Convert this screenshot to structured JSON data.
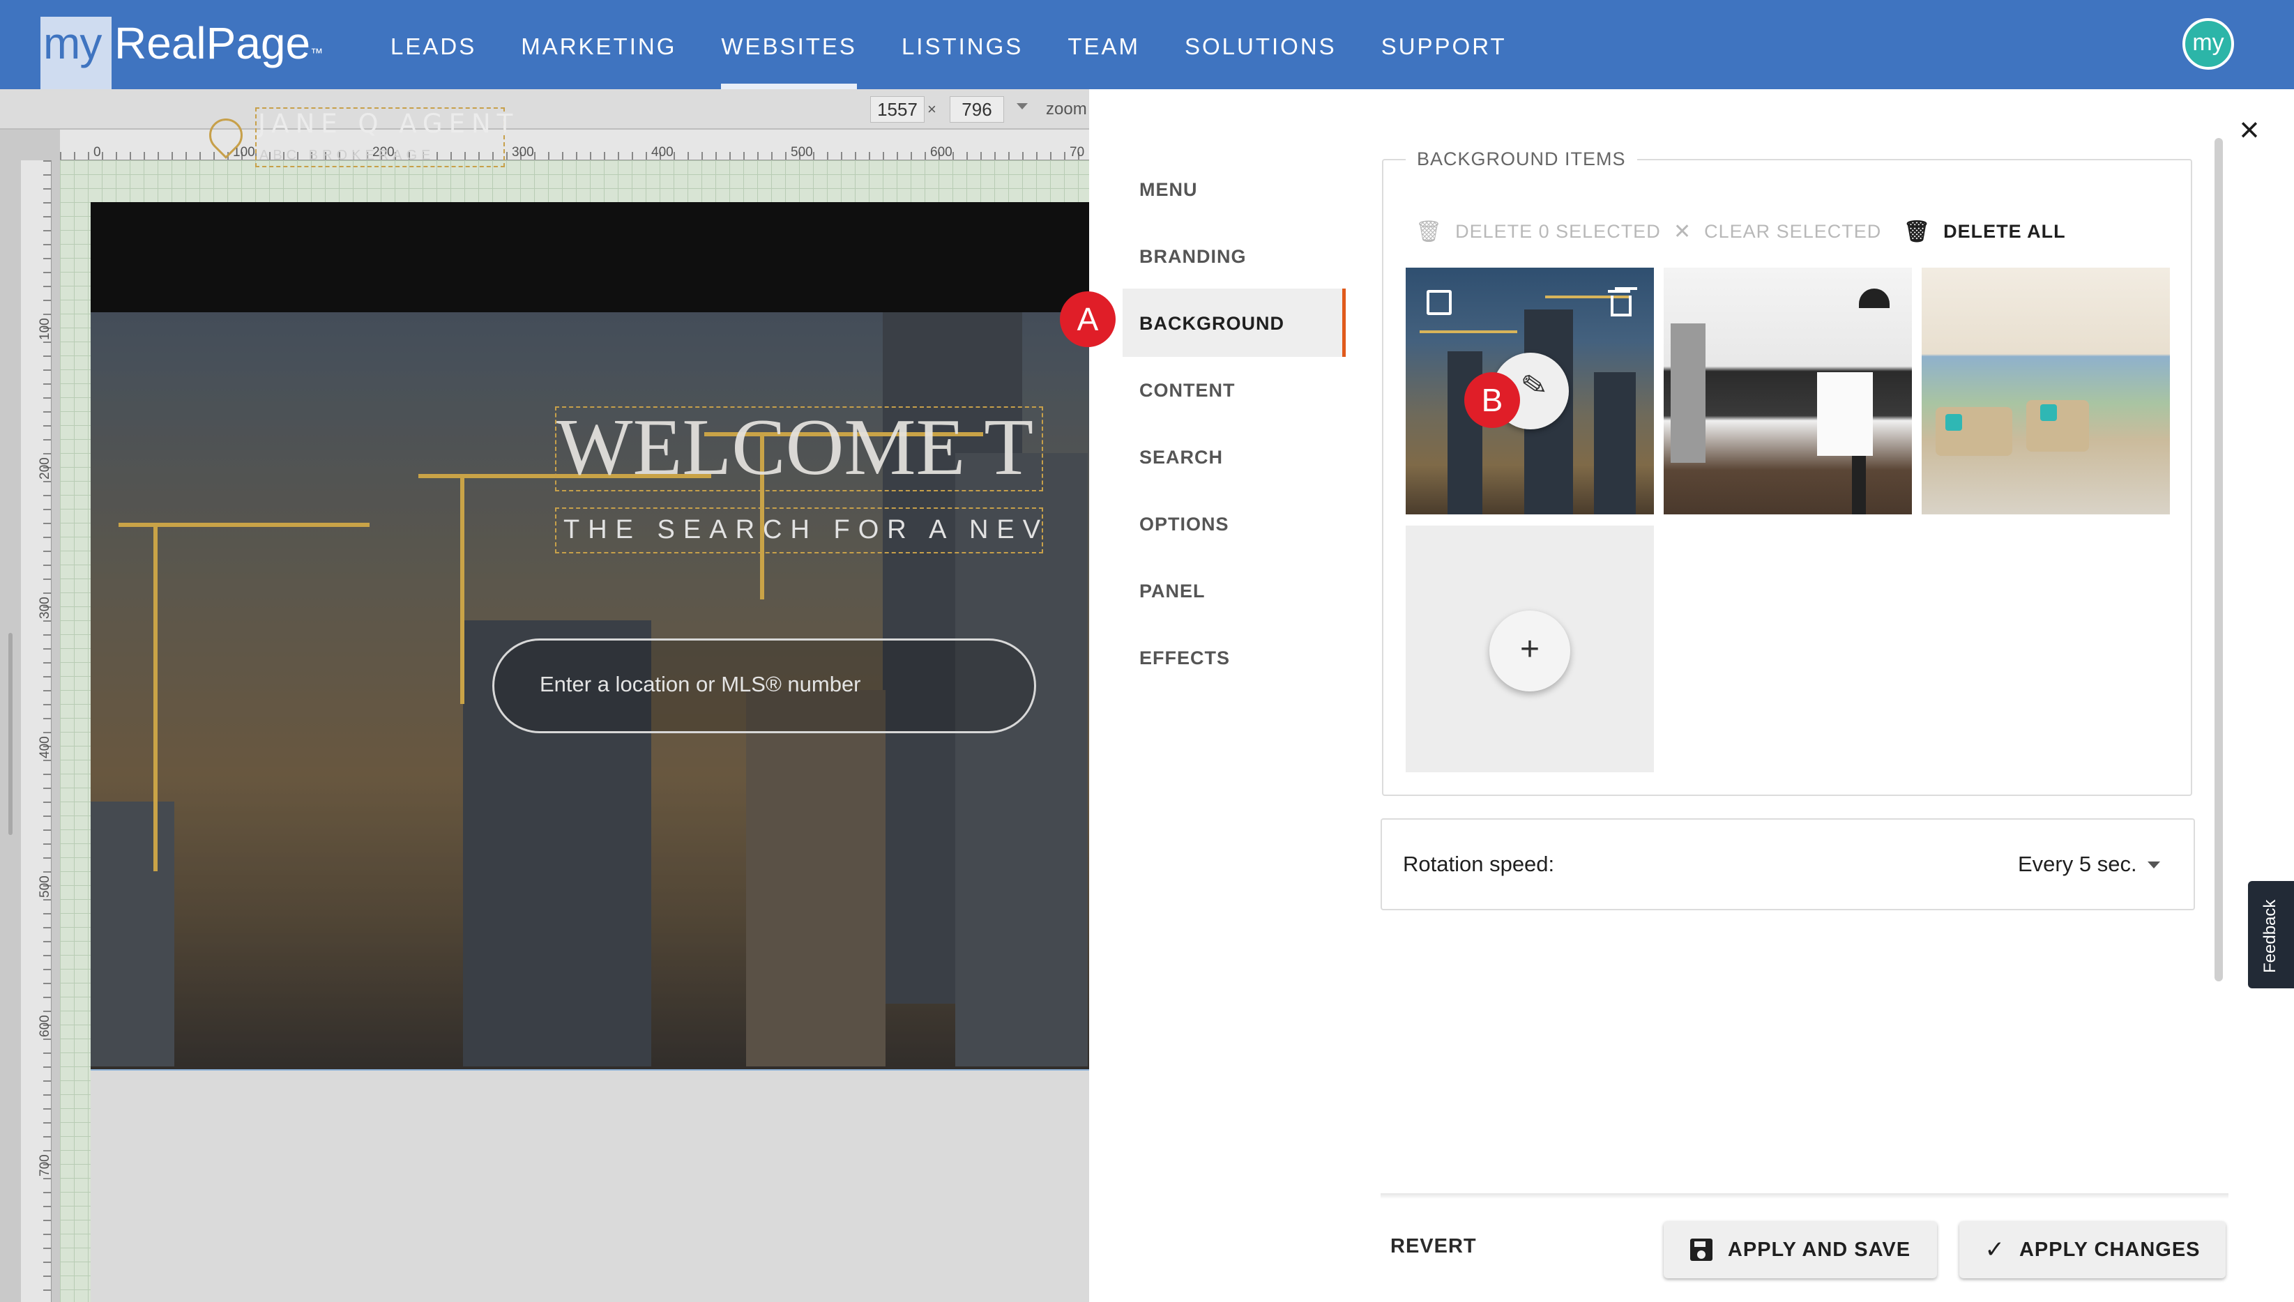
{
  "app": {
    "logo_my": "my",
    "logo_brand": "RealPage",
    "logo_tm": "™",
    "avatar_text": "my"
  },
  "nav": {
    "items": [
      "LEADS",
      "MARKETING",
      "WEBSITES",
      "LISTINGS",
      "TEAM",
      "SOLUTIONS",
      "SUPPORT"
    ],
    "active": "WEBSITES"
  },
  "editor": {
    "width_value": "1557",
    "height_value": "796",
    "separator": "×",
    "zoom_label": "zoom",
    "ruler_top": [
      "0",
      "100",
      "200",
      "300",
      "400",
      "500",
      "600",
      "70"
    ],
    "ruler_left": [
      "100",
      "200",
      "300",
      "400",
      "500",
      "600",
      "700"
    ]
  },
  "site_preview": {
    "agent_name": "JANE Q AGENT",
    "brokerage": "ABC BROKERAGE",
    "welcome": "WELCOME T",
    "tagline": "THE SEARCH FOR A NEV",
    "search_placeholder": "Enter a location or MLS® number"
  },
  "panel": {
    "menu": [
      "MENU",
      "BRANDING",
      "BACKGROUND",
      "CONTENT",
      "SEARCH",
      "OPTIONS",
      "PANEL",
      "EFFECTS"
    ],
    "active_menu": "BACKGROUND",
    "group_title": "BACKGROUND ITEMS",
    "delete_selected": "DELETE 0 SELECTED",
    "clear_selected": "CLEAR SELECTED",
    "delete_all": "DELETE ALL",
    "rotation_label": "Rotation speed:",
    "rotation_value": "Every 5 sec.",
    "add_label": "+",
    "revert": "REVERT",
    "apply_save": "APPLY AND SAVE",
    "apply_changes": "APPLY CHANGES",
    "feedback": "Feedback"
  },
  "annotations": {
    "marker_a": "A",
    "marker_b": "B"
  },
  "colors": {
    "nav_bg": "#3f74c0",
    "accent": "#e05a1c",
    "marker": "#e01e28"
  }
}
